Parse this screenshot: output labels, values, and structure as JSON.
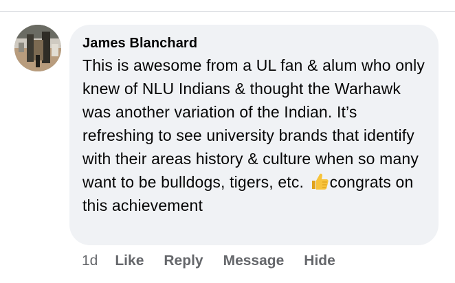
{
  "comment": {
    "author": "James Blanchard",
    "text_main": "This is awesome from a UL fan & alum who only knew of NLU Indians & thought the Warhawk was another variation of the Indian. It’s refreshing to see university brands that identify with their areas history & culture when so many want to be bulldogs, tigers, etc. ",
    "emoji": "thumbs-up-icon",
    "text_end": "congrats on this achievement"
  },
  "actions": {
    "timestamp": "1d",
    "like_label": "Like",
    "reply_label": "Reply",
    "message_label": "Message",
    "hide_label": "Hide"
  },
  "colors": {
    "bubble": "#f0f2f5",
    "meta_text": "#65676b",
    "body_text": "#050505",
    "divider": "#dadde1",
    "emoji": "#f7c33b"
  }
}
